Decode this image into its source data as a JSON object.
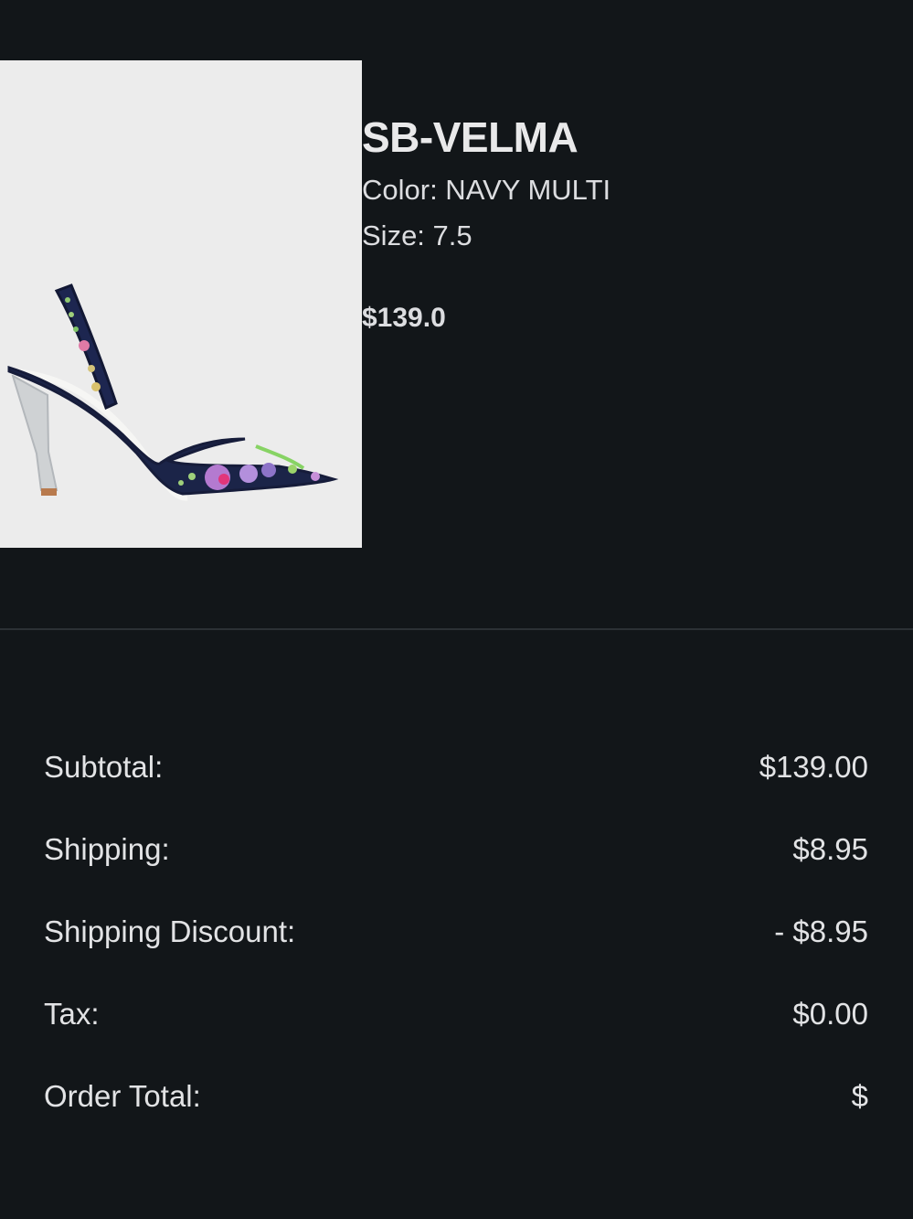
{
  "product": {
    "image_alt": "shoe-image",
    "name": "SB-VELMA",
    "color_label": "Color: NAVY MULTI",
    "size_label": "Size: 7.5",
    "price": "$139.0"
  },
  "summary": {
    "rows": [
      {
        "label": "Subtotal:",
        "value": "$139.00"
      },
      {
        "label": "Shipping:",
        "value": "$8.95"
      },
      {
        "label": "Shipping Discount:",
        "value": "- $8.95"
      },
      {
        "label": "Tax:",
        "value": "$0.00"
      },
      {
        "label": "Order Total:",
        "value": "$"
      }
    ]
  },
  "colors": {
    "background": "#121619",
    "text": "#e6e7e8",
    "image_bg": "#ececec",
    "divider": "#2c3135"
  }
}
